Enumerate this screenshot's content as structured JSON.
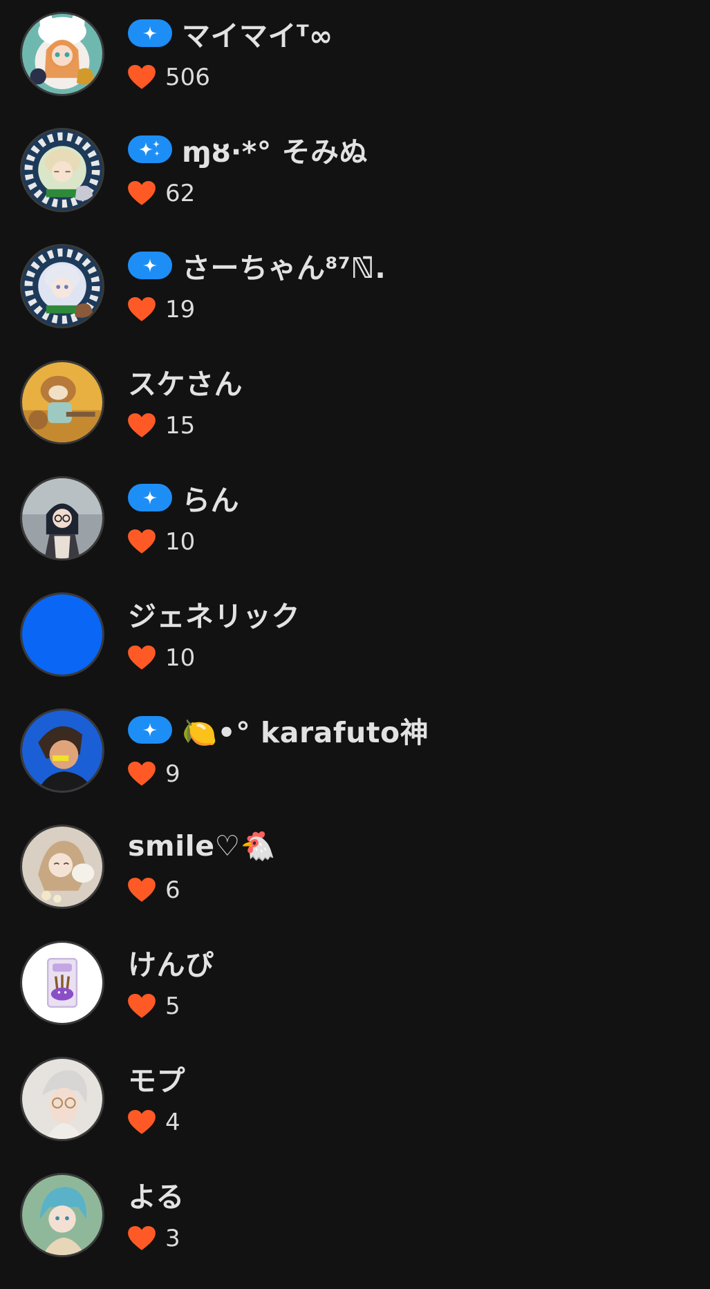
{
  "icons": {
    "badge": "sparkle-icon",
    "badge_double": "sparkles-icon",
    "like": "heart-icon"
  },
  "colors": {
    "background": "#121212",
    "badge": "#1e8ef7",
    "heart": "#ff5a26",
    "text": "#e2e2e2"
  },
  "users": [
    {
      "name": "マイマイᵀ∞",
      "likes": "506",
      "badge": true,
      "badge_icon": "sparkle-icon",
      "avatar": "anime-girl-bunny-hood"
    },
    {
      "name": "ɱȣ·*° そみぬ",
      "likes": "62",
      "badge": true,
      "badge_icon": "sparkles-icon",
      "avatar": "anime-girl-checkered-frame"
    },
    {
      "name": "さーちゃん⁸⁷ℕ̄.",
      "likes": "19",
      "badge": true,
      "badge_icon": "sparkle-icon",
      "avatar": "anime-girl-checkered-frame"
    },
    {
      "name": "スケさん",
      "likes": "15",
      "badge": false,
      "avatar": "hamster-character"
    },
    {
      "name": "らん",
      "likes": "10",
      "badge": true,
      "badge_icon": "sparkle-icon",
      "avatar": "anime-girl-glasses"
    },
    {
      "name": "ジェネリック",
      "likes": "10",
      "badge": false,
      "avatar": "solid-blue"
    },
    {
      "name": "🍋•° karafuto神",
      "likes": "9",
      "badge": true,
      "badge_icon": "sparkle-icon",
      "avatar": "anime-boy-blue"
    },
    {
      "name": "smile♡🐔",
      "likes": "6",
      "badge": false,
      "avatar": "anime-girl-with-dog"
    },
    {
      "name": "けんぴ",
      "likes": "5",
      "badge": false,
      "avatar": "snack-bag"
    },
    {
      "name": "モプ",
      "likes": "4",
      "badge": false,
      "avatar": "anime-boy-glasses"
    },
    {
      "name": "よる",
      "likes": "3",
      "badge": false,
      "avatar": "anime-boy-teal-hair"
    }
  ]
}
